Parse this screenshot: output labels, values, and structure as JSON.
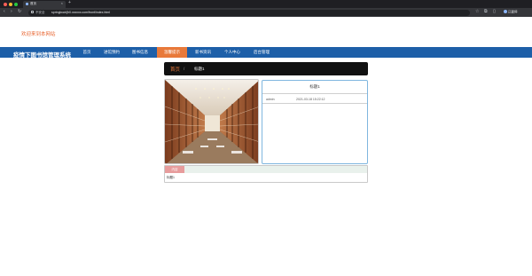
{
  "browser": {
    "tab_title": "首页",
    "tab_close": "×",
    "new_tab": "+",
    "insecure_label": "不安全",
    "url": "springboot/jh0.xxxxxx.com/front/index.html",
    "profile_label": "已暂停",
    "nav": {
      "back": "‹",
      "forward": "›",
      "reload": "↻"
    }
  },
  "page": {
    "welcome_text": "欢迎来到本网站",
    "site_title": "疫情下图书馆管理系统",
    "nav_items": [
      {
        "label": "首页",
        "active": false
      },
      {
        "label": "进馆预约",
        "active": false
      },
      {
        "label": "图书信息",
        "active": false
      },
      {
        "label": "温馨提示",
        "active": true
      },
      {
        "label": "新书资讯",
        "active": false
      },
      {
        "label": "个人中心",
        "active": false
      },
      {
        "label": "后台管理",
        "active": false
      }
    ],
    "breadcrumb": {
      "home": "首页",
      "separator": "/",
      "current": "标题1"
    },
    "info": {
      "title": "标题1",
      "user": "admin",
      "time": "2021-03-18 15:22:12"
    },
    "detail": {
      "tab_label": "内容",
      "content": "标题1"
    }
  },
  "colors": {
    "nav_blue": "#1d5fa8",
    "accent_orange": "#e8793a",
    "welcome_orange": "#e8642f"
  }
}
